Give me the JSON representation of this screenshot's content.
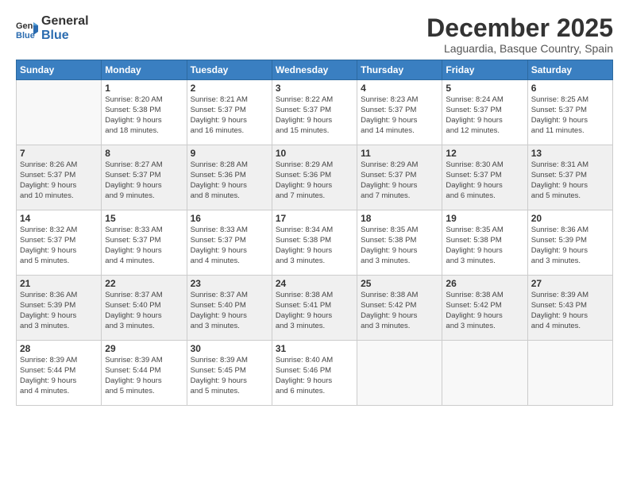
{
  "logo": {
    "general": "General",
    "blue": "Blue"
  },
  "header": {
    "month": "December 2025",
    "location": "Laguardia, Basque Country, Spain"
  },
  "weekdays": [
    "Sunday",
    "Monday",
    "Tuesday",
    "Wednesday",
    "Thursday",
    "Friday",
    "Saturday"
  ],
  "weeks": [
    [
      {
        "day": "",
        "info": ""
      },
      {
        "day": "1",
        "info": "Sunrise: 8:20 AM\nSunset: 5:38 PM\nDaylight: 9 hours\nand 18 minutes."
      },
      {
        "day": "2",
        "info": "Sunrise: 8:21 AM\nSunset: 5:37 PM\nDaylight: 9 hours\nand 16 minutes."
      },
      {
        "day": "3",
        "info": "Sunrise: 8:22 AM\nSunset: 5:37 PM\nDaylight: 9 hours\nand 15 minutes."
      },
      {
        "day": "4",
        "info": "Sunrise: 8:23 AM\nSunset: 5:37 PM\nDaylight: 9 hours\nand 14 minutes."
      },
      {
        "day": "5",
        "info": "Sunrise: 8:24 AM\nSunset: 5:37 PM\nDaylight: 9 hours\nand 12 minutes."
      },
      {
        "day": "6",
        "info": "Sunrise: 8:25 AM\nSunset: 5:37 PM\nDaylight: 9 hours\nand 11 minutes."
      }
    ],
    [
      {
        "day": "7",
        "info": "Sunrise: 8:26 AM\nSunset: 5:37 PM\nDaylight: 9 hours\nand 10 minutes."
      },
      {
        "day": "8",
        "info": "Sunrise: 8:27 AM\nSunset: 5:37 PM\nDaylight: 9 hours\nand 9 minutes."
      },
      {
        "day": "9",
        "info": "Sunrise: 8:28 AM\nSunset: 5:36 PM\nDaylight: 9 hours\nand 8 minutes."
      },
      {
        "day": "10",
        "info": "Sunrise: 8:29 AM\nSunset: 5:36 PM\nDaylight: 9 hours\nand 7 minutes."
      },
      {
        "day": "11",
        "info": "Sunrise: 8:29 AM\nSunset: 5:37 PM\nDaylight: 9 hours\nand 7 minutes."
      },
      {
        "day": "12",
        "info": "Sunrise: 8:30 AM\nSunset: 5:37 PM\nDaylight: 9 hours\nand 6 minutes."
      },
      {
        "day": "13",
        "info": "Sunrise: 8:31 AM\nSunset: 5:37 PM\nDaylight: 9 hours\nand 5 minutes."
      }
    ],
    [
      {
        "day": "14",
        "info": "Sunrise: 8:32 AM\nSunset: 5:37 PM\nDaylight: 9 hours\nand 5 minutes."
      },
      {
        "day": "15",
        "info": "Sunrise: 8:33 AM\nSunset: 5:37 PM\nDaylight: 9 hours\nand 4 minutes."
      },
      {
        "day": "16",
        "info": "Sunrise: 8:33 AM\nSunset: 5:37 PM\nDaylight: 9 hours\nand 4 minutes."
      },
      {
        "day": "17",
        "info": "Sunrise: 8:34 AM\nSunset: 5:38 PM\nDaylight: 9 hours\nand 3 minutes."
      },
      {
        "day": "18",
        "info": "Sunrise: 8:35 AM\nSunset: 5:38 PM\nDaylight: 9 hours\nand 3 minutes."
      },
      {
        "day": "19",
        "info": "Sunrise: 8:35 AM\nSunset: 5:38 PM\nDaylight: 9 hours\nand 3 minutes."
      },
      {
        "day": "20",
        "info": "Sunrise: 8:36 AM\nSunset: 5:39 PM\nDaylight: 9 hours\nand 3 minutes."
      }
    ],
    [
      {
        "day": "21",
        "info": "Sunrise: 8:36 AM\nSunset: 5:39 PM\nDaylight: 9 hours\nand 3 minutes."
      },
      {
        "day": "22",
        "info": "Sunrise: 8:37 AM\nSunset: 5:40 PM\nDaylight: 9 hours\nand 3 minutes."
      },
      {
        "day": "23",
        "info": "Sunrise: 8:37 AM\nSunset: 5:40 PM\nDaylight: 9 hours\nand 3 minutes."
      },
      {
        "day": "24",
        "info": "Sunrise: 8:38 AM\nSunset: 5:41 PM\nDaylight: 9 hours\nand 3 minutes."
      },
      {
        "day": "25",
        "info": "Sunrise: 8:38 AM\nSunset: 5:42 PM\nDaylight: 9 hours\nand 3 minutes."
      },
      {
        "day": "26",
        "info": "Sunrise: 8:38 AM\nSunset: 5:42 PM\nDaylight: 9 hours\nand 3 minutes."
      },
      {
        "day": "27",
        "info": "Sunrise: 8:39 AM\nSunset: 5:43 PM\nDaylight: 9 hours\nand 4 minutes."
      }
    ],
    [
      {
        "day": "28",
        "info": "Sunrise: 8:39 AM\nSunset: 5:44 PM\nDaylight: 9 hours\nand 4 minutes."
      },
      {
        "day": "29",
        "info": "Sunrise: 8:39 AM\nSunset: 5:44 PM\nDaylight: 9 hours\nand 5 minutes."
      },
      {
        "day": "30",
        "info": "Sunrise: 8:39 AM\nSunset: 5:45 PM\nDaylight: 9 hours\nand 5 minutes."
      },
      {
        "day": "31",
        "info": "Sunrise: 8:40 AM\nSunset: 5:46 PM\nDaylight: 9 hours\nand 6 minutes."
      },
      {
        "day": "",
        "info": ""
      },
      {
        "day": "",
        "info": ""
      },
      {
        "day": "",
        "info": ""
      }
    ]
  ]
}
